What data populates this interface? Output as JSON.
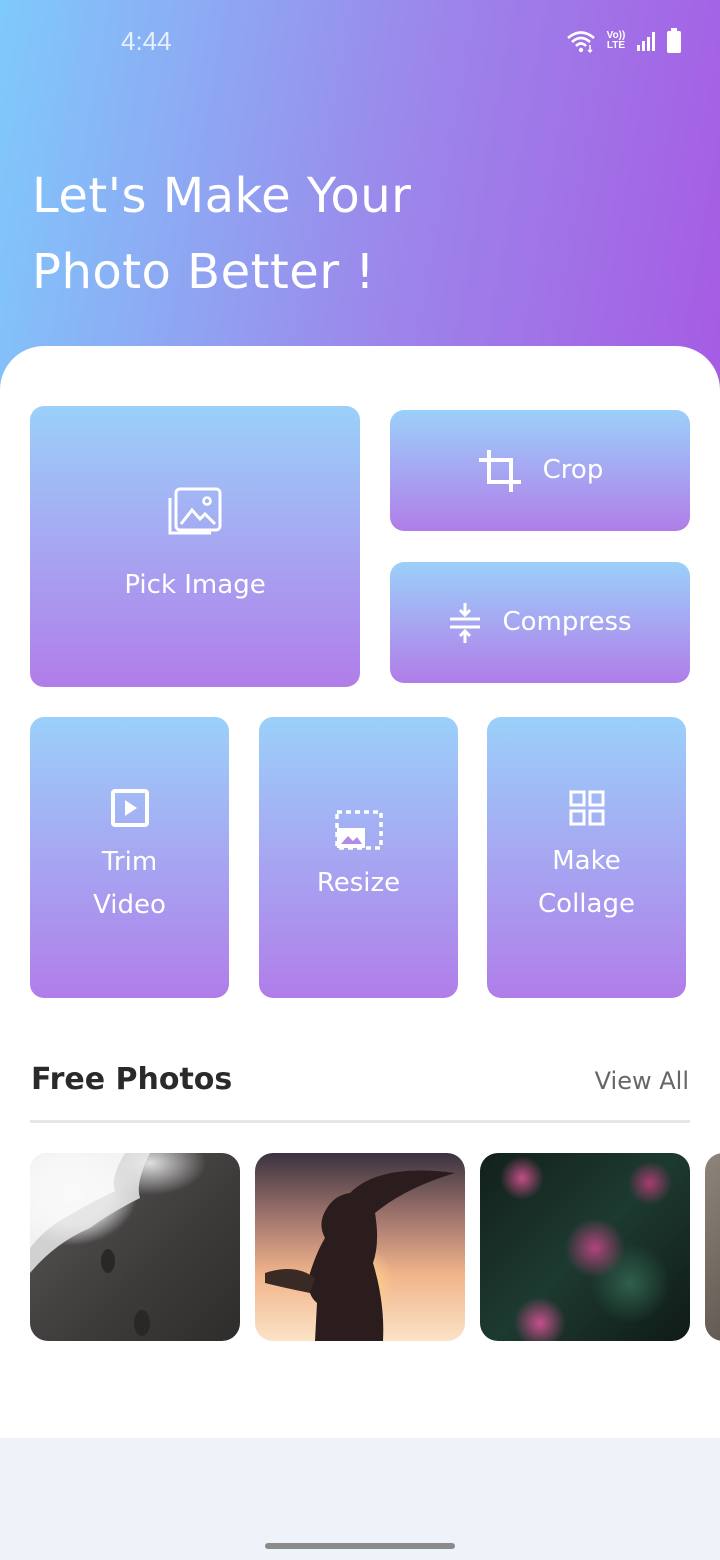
{
  "status_bar": {
    "time": "4:44",
    "volte_label": "Vo))\nLTE",
    "icons": [
      "wifi-icon",
      "volte-icon",
      "signal-icon",
      "battery-icon"
    ]
  },
  "header": {
    "headline_line1": "Let's Make Your",
    "headline_line2": "Photo Better !"
  },
  "tools": {
    "pick_image": {
      "label": "Pick Image",
      "icon": "image-icon"
    },
    "crop": {
      "label": "Crop",
      "icon": "crop-icon"
    },
    "compress": {
      "label": "Compress",
      "icon": "compress-icon"
    },
    "trim_video": {
      "label_line1": "Trim",
      "label_line2": "Video",
      "icon": "play-box-icon"
    },
    "resize": {
      "label": "Resize",
      "icon": "resize-icon"
    },
    "make_collage": {
      "label_line1": "Make",
      "label_line2": "Collage",
      "icon": "collage-icon"
    }
  },
  "free_photos": {
    "title": "Free Photos",
    "view_all": "View All",
    "items": [
      {
        "subject": "beach footprints"
      },
      {
        "subject": "woman silhouette sunset"
      },
      {
        "subject": "pink flowers leaves"
      },
      {
        "subject": "partial fourth photo"
      }
    ]
  },
  "colors": {
    "header_gradient_start": "#7fcafc",
    "header_gradient_end": "#a65ae3",
    "tile_gradient_top": "#9bd0fa",
    "tile_gradient_bottom": "#b17de9",
    "sheet_background": "#ffffff",
    "footer_background": "#eef3fa"
  }
}
